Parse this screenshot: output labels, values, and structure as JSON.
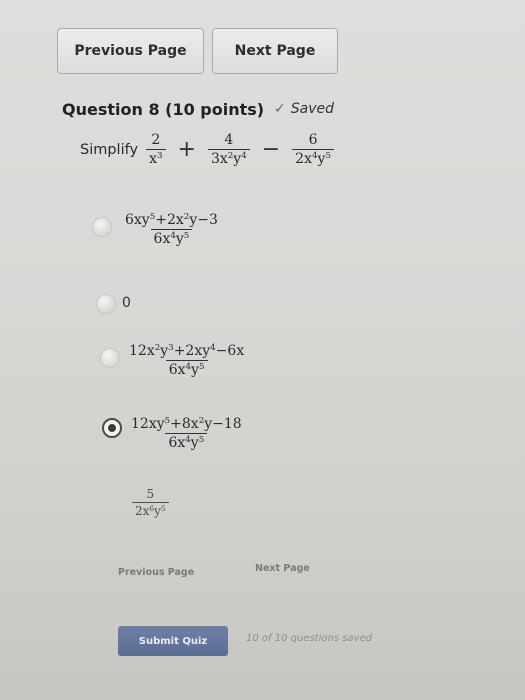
{
  "nav": {
    "previous_label": "Previous Page",
    "next_label": "Next Page"
  },
  "question": {
    "title": "Question 8 (10 points)",
    "saved_label": "Saved",
    "prompt_label": "Simplify",
    "expression": {
      "term1": {
        "num": "2",
        "den_base": "x",
        "den_exp": "3"
      },
      "op1": "+",
      "term2": {
        "num": "4",
        "den": "3x",
        "den_exp1": "2",
        "den_y": "y",
        "den_exp2": "4"
      },
      "op2": "−",
      "term3": {
        "num": "6",
        "den": "2x",
        "den_exp1": "4",
        "den_y": "y",
        "den_exp2": "5"
      }
    }
  },
  "options": [
    {
      "selected": false,
      "num": "6xy^5+2x^2y−3",
      "den": "6x^4y^5"
    },
    {
      "selected": false,
      "plain": "0"
    },
    {
      "selected": false,
      "num": "12x^2y^3+2xy^4−6x",
      "den": "6x^4y^5"
    },
    {
      "selected": true,
      "num": "12xy^5+8x^2y−18",
      "den": "6x^4y^5"
    },
    {
      "selected": false,
      "num": "5",
      "den": "2x^6y^5"
    }
  ],
  "footer": {
    "previous_label": "Previous Page",
    "next_label": "Next Page",
    "submit_label": "Submit Quiz",
    "status_text": "10 of 10 questions saved"
  }
}
